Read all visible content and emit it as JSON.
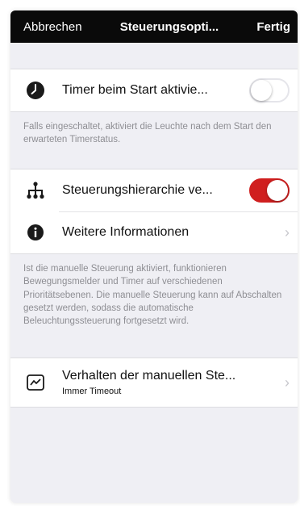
{
  "navbar": {
    "cancel_label": "Abbrechen",
    "title": "Steuerungsopti...",
    "done_label": "Fertig"
  },
  "sections": {
    "timer": {
      "icon": "clock-icon",
      "label": "Timer beim Start aktivie...",
      "toggle_on": false,
      "footer": "Falls eingeschaltet, aktiviert die Leuchte nach dem Start den erwarteten Timerstatus."
    },
    "hierarchy": {
      "icon": "hierarchy-icon",
      "label": "Steuerungshierarchie ve...",
      "toggle_on": true,
      "info_icon": "info-icon",
      "info_label": "Weitere Informationen",
      "footer": "Ist die manuelle Steuerung aktiviert, funktionieren Bewegungsmelder und Timer auf verschiedenen Prioritätsebenen. Die manuelle Steuerung kann auf Abschalten gesetzt werden, sodass die automatische Beleuchtungssteuerung fortgesetzt wird."
    },
    "manual": {
      "icon": "manual-control-icon",
      "label": "Verhalten der manuellen Ste...",
      "value": "Immer Timeout"
    }
  },
  "colors": {
    "accent": "#d01f1f",
    "navbar_bg": "#0a0a0a",
    "background": "#efeff4"
  }
}
